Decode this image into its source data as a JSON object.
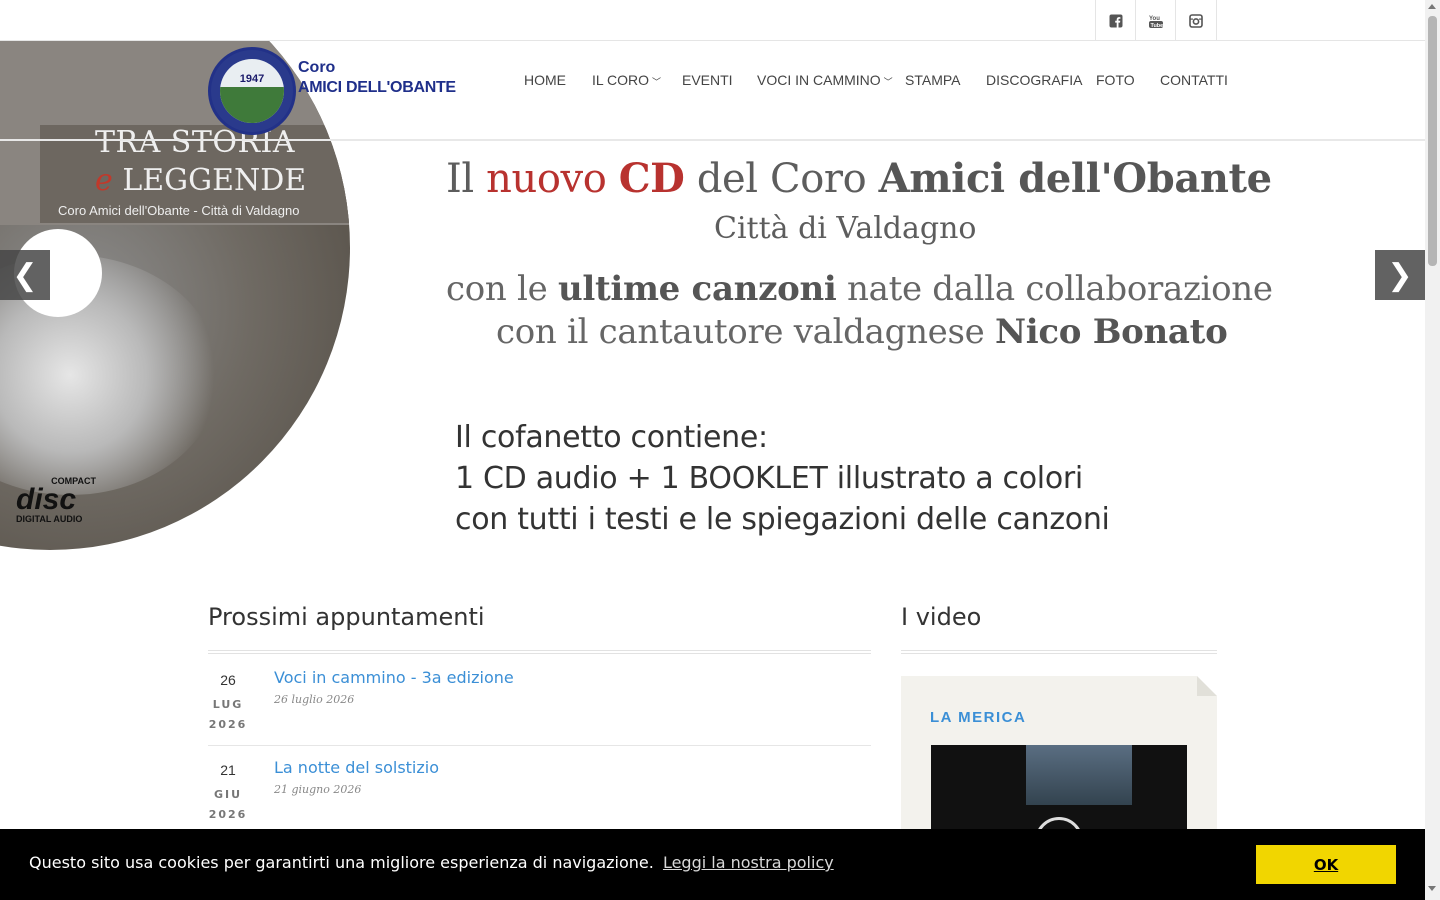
{
  "social": {
    "facebook_icon": "facebook-icon",
    "youtube_icon": "youtube-icon",
    "instagram_icon": "instagram-icon"
  },
  "logo": {
    "year": "1947",
    "line1": "Coro",
    "line2": "AMICI DELL'OBANTE"
  },
  "nav": {
    "items": [
      {
        "label": "HOME"
      },
      {
        "label": "IL CORO",
        "dropdown": true
      },
      {
        "label": "EVENTI"
      },
      {
        "label": "VOCI IN CAMMINO",
        "dropdown": true
      },
      {
        "label": "STAMPA"
      },
      {
        "label": "DISCOGRAFIA"
      },
      {
        "label": "FOTO"
      },
      {
        "label": "CONTATTI"
      }
    ]
  },
  "hero": {
    "cd_title_line1": "TRA STORIA",
    "cd_title_e": "e",
    "cd_title_line2": "LEGGENDE",
    "cd_subtitle": "Coro Amici dell'Obante - Città di Valdagno",
    "cd_logo_a": "COMPACT",
    "cd_logo_b": "disc",
    "cd_logo_c": "DIGITAL AUDIO",
    "headline_il": "Il",
    "headline_nuovo": "nuovo",
    "headline_cd": "CD",
    "headline_del_coro": "del Coro",
    "headline_name": "Amici dell'Obante",
    "headline_city": "Città di Valdagno",
    "line3_a": "con le",
    "line3_b": "ultime canzoni",
    "line3_c": "nate dalla collaborazione",
    "line4_a": "con il cantautore valdagnese",
    "line4_b": "Nico Bonato",
    "box_line1": "Il cofanetto contiene:",
    "box_line2": "1 CD audio + 1 BOOKLET illustrato a colori",
    "box_line3": "con tutti i testi e le spiegazioni delle canzoni",
    "prev_label": "❮",
    "next_label": "❯"
  },
  "events": {
    "title": "Prossimi appuntamenti",
    "items": [
      {
        "day": "26",
        "month": "LUG",
        "year": "2026",
        "title": "Voci in cammino - 3a edizione",
        "date": "26 luglio 2026"
      },
      {
        "day": "21",
        "month": "GIU",
        "year": "2026",
        "title": "La notte del solstizio",
        "date": "21 giugno 2026"
      }
    ]
  },
  "videos": {
    "title": "I video",
    "card_title": "LA MERICA"
  },
  "cookie": {
    "message": "Questo sito usa cookies per garantirti una migliore esperienza di navigazione.",
    "link": "Leggi la nostra policy",
    "ok": "OK"
  },
  "colors": {
    "link_blue": "#3b8fd6",
    "cookie_yellow": "#f1d600",
    "logo_blue": "#1f2f8a",
    "headline_red": "#b8322f"
  }
}
